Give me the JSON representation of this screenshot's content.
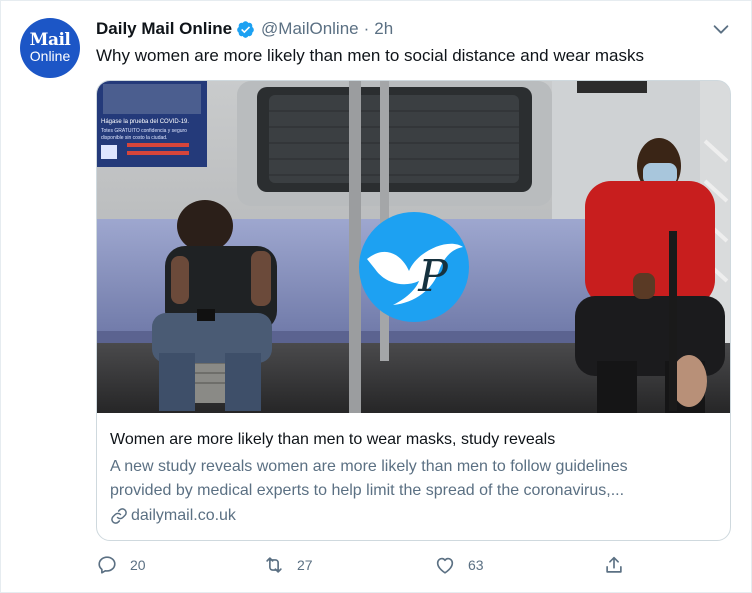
{
  "account": {
    "avatar_line1": "Mail",
    "avatar_line2": "Online",
    "display_name": "Daily Mail Online",
    "handle": "@MailOnline",
    "separator": "·",
    "time": "2h"
  },
  "tweet": {
    "text": "Why women are more likely than men to social distance and wear masks"
  },
  "card": {
    "title": "Women are more likely than men to wear masks, study reveals",
    "description_line1": "A new study reveals women are more likely than men to follow guidelines",
    "description_line2": "provided by medical experts to help limit the spread of the coronavirus,...",
    "domain": "dailymail.co.uk",
    "poster_line1": "Hágase la prueba del COVID-19.",
    "poster_line2": "Totes GRATUITO confidencia y seguro",
    "poster_line3": "disponible sin costo la ciudad.",
    "watermark_letter": "P"
  },
  "actions": {
    "reply_count": "20",
    "retweet_count": "27",
    "like_count": "63"
  },
  "icons": {
    "verified": "verified-badge-icon",
    "caret": "chevron-down-icon",
    "link": "link-icon",
    "reply": "reply-icon",
    "retweet": "retweet-icon",
    "like": "heart-icon",
    "share": "share-icon"
  },
  "colors": {
    "brand_blue": "#1da1f2",
    "secondary_text": "#5b7083",
    "avatar_bg": "#1c56c6"
  }
}
